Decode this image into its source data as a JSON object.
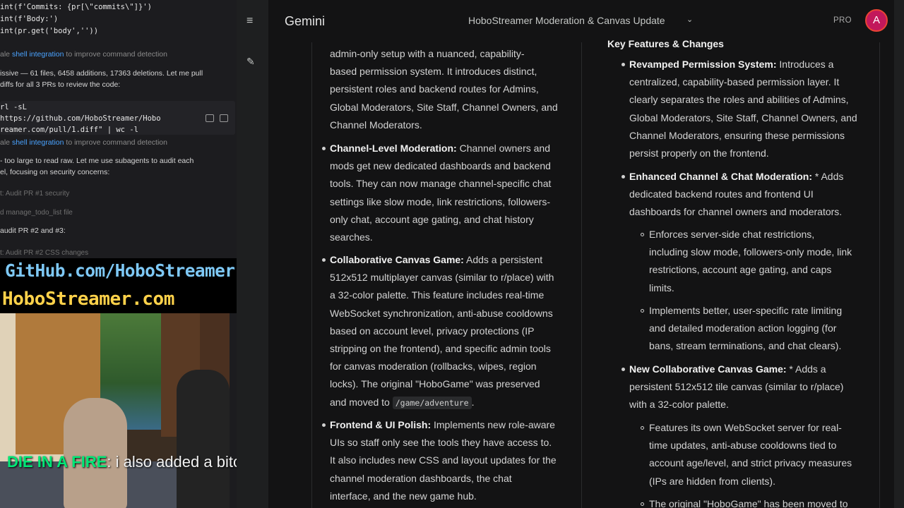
{
  "terminal": {
    "code_lines": [
      "int(f'Commits: {pr[\\\"commits\\\"]}')",
      "int(f'Body:')",
      "int(pr.get('body',''))"
    ],
    "note1_prefix": "ale",
    "note1_link": "shell integration",
    "note1_suffix": "to improve command detection",
    "summary_line1": "issive — 61 files, 6458 additions, 17363 deletions. Let me pull",
    "summary_line2": "diffs for all 3 PRs to review the code:",
    "cmd_line1": "rl -sL",
    "cmd_line2": "https://github.com/HoboStreamer/Hobo",
    "cmd_line3": "reamer.com/pull/1.diff\" | wc -l",
    "note2_prefix": "ale",
    "note2_link": "shell integration",
    "note2_suffix": "to improve command detection",
    "raw_line1": "- too large to read raw. Let me use subagents to audit each",
    "raw_line2": "el, focusing on security concerns:",
    "faint1": "t: Audit PR #1 security",
    "faint2": "d manage_todo_list file",
    "audit_line": "audit PR #2 and #3:",
    "faint3": "t: Audit PR #2 CSS changes"
  },
  "overlay": {
    "github": "GitHub.com/HoboStreamer",
    "site": "HoboStreamer.com"
  },
  "stream_chat": {
    "username": "DIE IN A FIRE",
    "message": ": i also added a bitcoin miner"
  },
  "rail": {
    "menu_icon": "≡",
    "new_chat_icon": "✎"
  },
  "gemini": {
    "brand": "Gemini",
    "chat_title": "HoboStreamer Moderation & Canvas Update",
    "chevron": "⌄",
    "pro_label": "PRO",
    "avatar_letter": "A"
  },
  "left_column": {
    "intro_line1": "admin-only setup with a nuanced, capability-",
    "intro_line2": "based permission system. It introduces distinct,",
    "intro_line3": "persistent roles and backend routes for Admins,",
    "intro_line4": "Global Moderators, Site Staff, Channel Owners, and",
    "intro_line5": "Channel Moderators.",
    "items": [
      {
        "title": "Channel-Level Moderation:",
        "lines": [
          " Channel owners and",
          "mods get new dedicated dashboards and backend",
          "tools. They can now manage channel-specific chat",
          "settings like slow mode, link restrictions, followers-",
          "only chat, account age gating, and chat history",
          "searches."
        ]
      },
      {
        "title": "Collaborative Canvas Game:",
        "lines": [
          " Adds a persistent",
          "512x512 multiplayer canvas (similar to r/place) with",
          "a 32-color palette. This feature includes real-time",
          "WebSocket synchronization, anti-abuse cooldowns",
          "based on account level, privacy protections (IP",
          "stripping on the frontend), and specific admin tools",
          "for canvas moderation (rollbacks, wipes, region",
          "locks). The original \"HoboGame\" was preserved",
          "and moved to "
        ],
        "code": "/game/adventure",
        "code_suffix": "."
      },
      {
        "title": "Frontend & UI Polish:",
        "lines": [
          " Implements new role-aware",
          "UIs so staff only see the tools they have access to.",
          "It also includes new CSS and layout updates for the",
          "channel moderation dashboards, the chat",
          "interface, and the new game hub."
        ]
      }
    ]
  },
  "right_column": {
    "heading": "Key Features & Changes",
    "items": [
      {
        "title": "Revamped Permission System:",
        "lines": [
          " Introduces a",
          "centralized, capability-based permission layer. It",
          "clearly separates the roles and abilities of Admins,",
          "Global Moderators, Site Staff, Channel Owners, and",
          "Channel Moderators, ensuring these permissions",
          "persist properly on the frontend."
        ]
      },
      {
        "title": "Enhanced Channel & Chat Moderation:",
        "lines": [
          " * Adds",
          "dedicated backend routes and frontend UI",
          "dashboards for channel owners and moderators."
        ],
        "sub": [
          [
            "Enforces server-side chat restrictions,",
            "including slow mode, followers-only mode, link",
            "restrictions, account age gating, and caps",
            "limits."
          ],
          [
            "Implements better, user-specific rate limiting",
            "and detailed moderation action logging (for",
            "bans, stream terminations, and chat clears)."
          ]
        ]
      },
      {
        "title": "New Collaborative Canvas Game:",
        "lines": [
          " * Adds a",
          "persistent 512x512 tile canvas (similar to r/place)",
          "with a 32-color palette."
        ],
        "sub": [
          [
            "Features its own WebSocket server for real-",
            "time updates, anti-abuse cooldowns tied to",
            "account age/level, and strict privacy measures",
            "(IPs are hidden from clients)."
          ],
          [
            "The original \"HoboGame\" has been moved to"
          ]
        ]
      }
    ]
  }
}
